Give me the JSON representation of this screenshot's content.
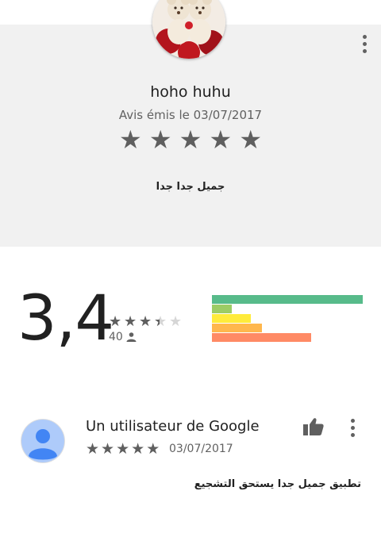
{
  "review": {
    "author": "hoho huhu",
    "date_label": "Avis émis le 03/07/2017",
    "stars": [
      "★",
      "★",
      "★",
      "★",
      "★"
    ],
    "text": "جميل جدا جدا"
  },
  "summary": {
    "score": "3,4",
    "count": "40",
    "average_rating": 3.4,
    "distribution": [
      {
        "stars": 5,
        "fraction": 1.0,
        "color": "#57bb8a"
      },
      {
        "stars": 4,
        "fraction": 0.13,
        "color": "#9ccc65"
      },
      {
        "stars": 3,
        "fraction": 0.26,
        "color": "#ffeb3b"
      },
      {
        "stars": 2,
        "fraction": 0.33,
        "color": "#ffb74d"
      },
      {
        "stars": 1,
        "fraction": 0.66,
        "color": "#ff8a65"
      }
    ]
  },
  "user_review": {
    "author": "Un utilisateur de Google",
    "stars": [
      "★",
      "★",
      "★",
      "★",
      "★"
    ],
    "date": "03/07/2017",
    "text": "تطبيق جميل جدا يستحق التشجيع"
  },
  "colors": {
    "star": "#5f5f5f",
    "card_bg": "#f1f1f1",
    "avatar_bg": "#aecbfa",
    "avatar_fg": "#4285f4"
  }
}
